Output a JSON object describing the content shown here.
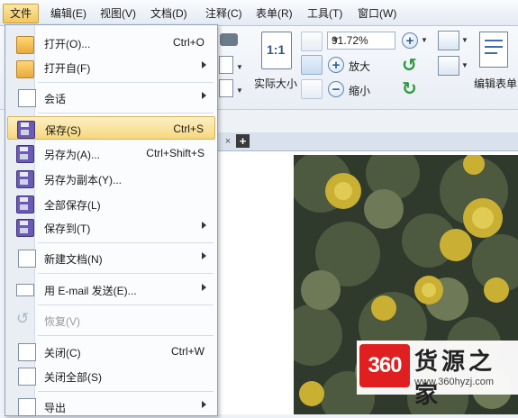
{
  "menubar": {
    "items": [
      "文件",
      "编辑(E)",
      "视图(V)",
      "文档(D)",
      "注释(C)",
      "表单(R)",
      "工具(T)",
      "窗口(W)"
    ]
  },
  "toolbar": {
    "actual_size_label": "实际大小",
    "actual_size_icon_text": "1:1",
    "zoom_value": "91.72%",
    "zoom_in_label": "放大",
    "zoom_out_label": "缩小",
    "edit_form_label": "编辑表单"
  },
  "file_menu": {
    "items": [
      {
        "label": "打开(O)...",
        "shortcut": "Ctrl+O",
        "submenu": false,
        "icon": "folder-open-icon"
      },
      {
        "label": "打开自(F)",
        "shortcut": "",
        "submenu": true,
        "icon": "folder-globe-icon"
      },
      {
        "label": "会话",
        "shortcut": "",
        "submenu": true,
        "icon": "session-icon"
      },
      {
        "label": "保存(S)",
        "shortcut": "Ctrl+S",
        "submenu": false,
        "icon": "save-icon",
        "highlighted": true
      },
      {
        "label": "另存为(A)...",
        "shortcut": "Ctrl+Shift+S",
        "submenu": false,
        "icon": "save-as-icon"
      },
      {
        "label": "另存为副本(Y)...",
        "shortcut": "",
        "submenu": false,
        "icon": "save-copy-icon"
      },
      {
        "label": "全部保存(L)",
        "shortcut": "",
        "submenu": false,
        "icon": "save-all-icon"
      },
      {
        "label": "保存到(T)",
        "shortcut": "",
        "submenu": true,
        "icon": "save-to-icon"
      },
      {
        "label": "新建文档(N)",
        "shortcut": "",
        "submenu": true,
        "icon": "new-document-icon"
      },
      {
        "label": "用 E-mail 发送(E)...",
        "shortcut": "",
        "submenu": true,
        "icon": "email-icon"
      },
      {
        "label": "恢复(V)",
        "shortcut": "",
        "submenu": false,
        "icon": "revert-icon",
        "disabled": true
      },
      {
        "label": "关闭(C)",
        "shortcut": "Ctrl+W",
        "submenu": false,
        "icon": "close-document-icon"
      },
      {
        "label": "关闭全部(S)",
        "shortcut": "",
        "submenu": false,
        "icon": "close-all-icon"
      },
      {
        "label": "导出",
        "shortcut": "",
        "submenu": true,
        "icon": "export-icon"
      }
    ]
  },
  "tabs": {
    "close_glyph": "×",
    "add_glyph": "+"
  },
  "watermark": {
    "logo": "360",
    "name": "货源之家",
    "url": "www.360hyzj.com"
  },
  "colors": {
    "menu_highlight": "#f6d77e",
    "menubar_active": "#f1c75e",
    "disk_purple": "#6b5bb5",
    "watermark_red": "#e02020"
  }
}
